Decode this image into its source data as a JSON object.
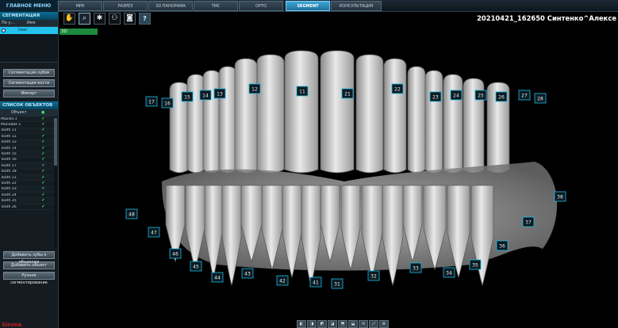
{
  "menu": {
    "main_label": "ГЛАВНОЕ МЕНЮ"
  },
  "tabs": [
    {
      "label": "MPR"
    },
    {
      "label": "РАЗРЕЗ"
    },
    {
      "label": "3D ПАНОРАМА"
    },
    {
      "label": "ТМС"
    },
    {
      "label": "ОРТО"
    },
    {
      "label": "SEGMENT"
    },
    {
      "label": "КОНСУЛЬТАЦИЯ"
    }
  ],
  "sidebar": {
    "patients_title": "СЕГМЕНТАЦИЯ",
    "patients_cols": [
      "По у...",
      "Имя"
    ],
    "patient_selected": "User",
    "buttons": [
      "Сегментация зубов",
      "Сегментация кости",
      "Импорт"
    ],
    "objects_title": "СПИСОК ОБЪЕКТОВ",
    "objects_head": "Объект",
    "objects": [
      "Maxilla 1",
      "Mandible 1",
      "Tooth 11",
      "Tooth 12",
      "Tooth 13",
      "Tooth 14",
      "Tooth 15",
      "Tooth 16",
      "Tooth 17",
      "Tooth 18",
      "Tooth 21",
      "Tooth 22",
      "Tooth 23",
      "Tooth 24",
      "Tooth 25",
      "Tooth 26"
    ],
    "bottom_buttons": [
      "Добавить зубы к объектам",
      "Добавить объект",
      "Ручное сегментирование"
    ],
    "logo": "Sirona"
  },
  "view": {
    "patient_title": "20210421_162650 Синтенко^Алексе",
    "label": "3D",
    "tooth_numbers_upper": [
      "17",
      "16",
      "15",
      "14",
      "13",
      "12",
      "11",
      "21",
      "22",
      "23",
      "24",
      "25",
      "26",
      "27",
      "28"
    ],
    "tooth_numbers_lower": [
      "48",
      "47",
      "46",
      "45",
      "44",
      "43",
      "42",
      "41",
      "31",
      "32",
      "33",
      "34",
      "35",
      "36",
      "37",
      "38"
    ]
  }
}
